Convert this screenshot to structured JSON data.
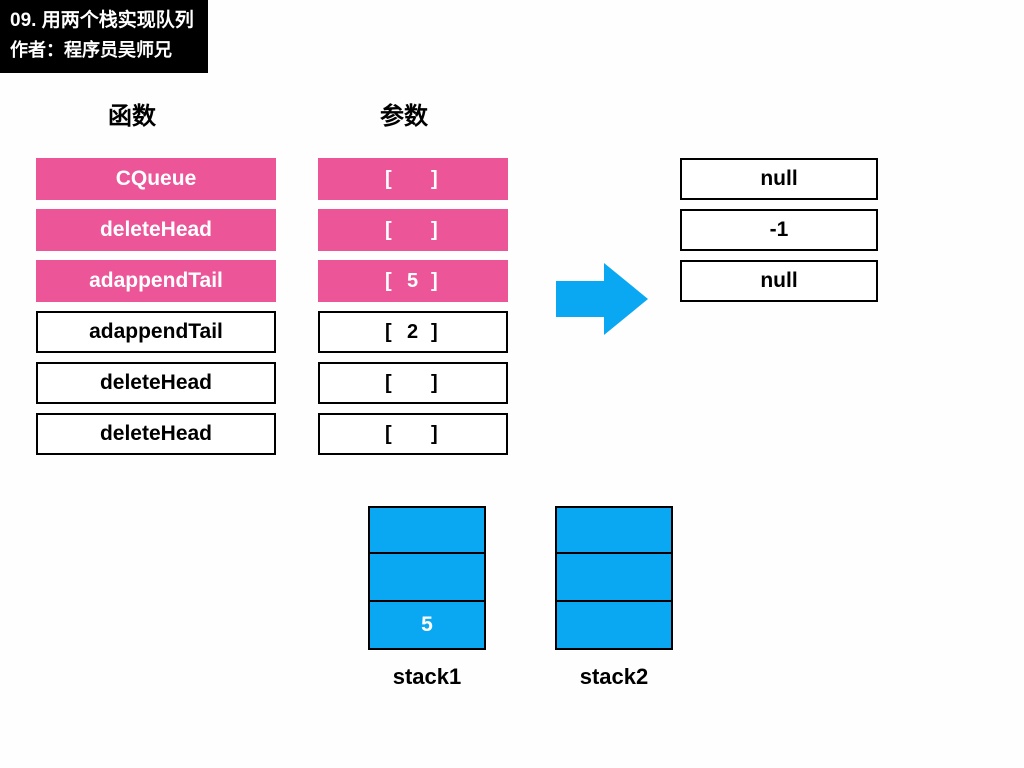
{
  "title": "09. 用两个栈实现队列",
  "author_prefix": "作者：",
  "author": "程序员吴师兄",
  "headers": {
    "functions": "函数",
    "params": "参数"
  },
  "functions": [
    {
      "label": "CQueue",
      "hl": true
    },
    {
      "label": "deleteHead",
      "hl": true
    },
    {
      "label": "adappendTail",
      "hl": true
    },
    {
      "label": "adappendTail",
      "hl": false
    },
    {
      "label": "deleteHead",
      "hl": false
    },
    {
      "label": "deleteHead",
      "hl": false
    }
  ],
  "params": [
    {
      "val": "",
      "hl": true
    },
    {
      "val": "",
      "hl": true
    },
    {
      "val": "5",
      "hl": true
    },
    {
      "val": "2",
      "hl": false
    },
    {
      "val": "",
      "hl": false
    },
    {
      "val": "",
      "hl": false
    }
  ],
  "results": [
    {
      "val": "null"
    },
    {
      "val": "-1"
    },
    {
      "val": "null"
    }
  ],
  "stacks": {
    "s1": {
      "label": "stack1",
      "slots": [
        "",
        "",
        "5"
      ]
    },
    "s2": {
      "label": "stack2",
      "slots": [
        "",
        "",
        ""
      ]
    }
  }
}
